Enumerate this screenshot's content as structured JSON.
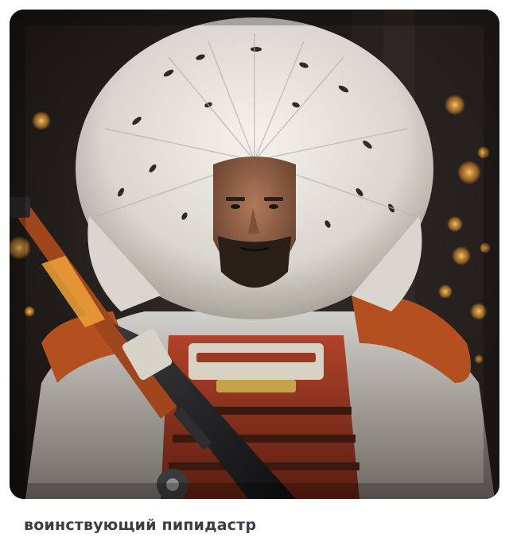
{
  "caption": "воинствующий пипидастр",
  "image": {
    "subject": "warrior-with-white-feather-headdress",
    "colors": {
      "background_dark": "#1c1f22",
      "bokeh": "#f0a23a",
      "feathers": "#e8e6e0",
      "feather_spots": "#2b2a28",
      "fur_orange": "#b4501f",
      "armor_red": "#8a2f1a",
      "gun_dark": "#1a1a1c",
      "skin": "#9a6a4a",
      "beard": "#2a1f18"
    }
  }
}
